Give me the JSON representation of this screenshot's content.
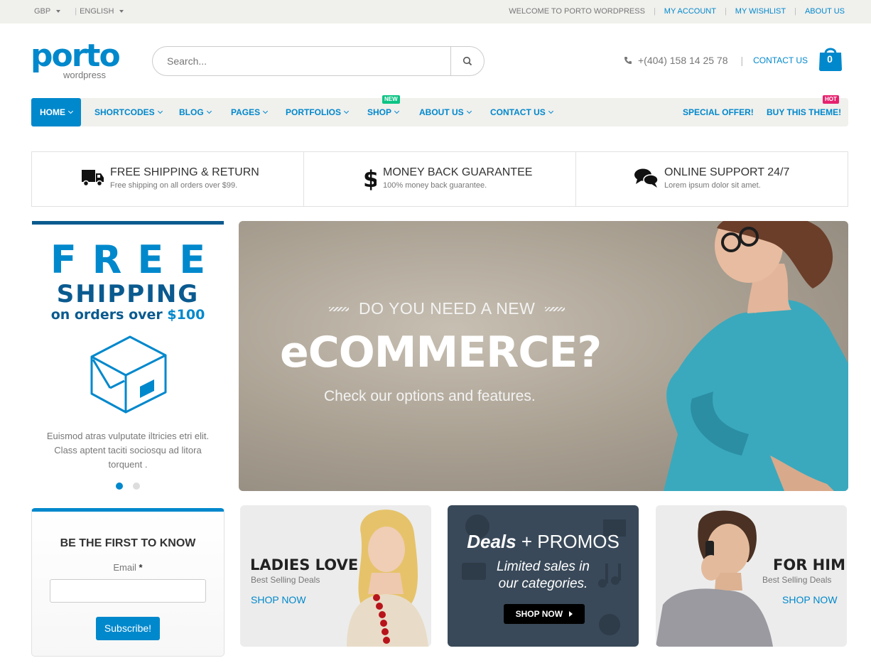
{
  "topbar": {
    "currency": "GBP",
    "language": "ENGLISH",
    "welcome": "WELCOME TO PORTO WORDPRESS",
    "links": [
      "MY ACCOUNT",
      "MY WISHLIST",
      "ABOUT US"
    ]
  },
  "header": {
    "logo_word": "porto",
    "logo_sub": "wordpress",
    "search_placeholder": "Search...",
    "phone": "+(404) 158 14 25 78",
    "contact": "CONTACT US",
    "cart_count": "0"
  },
  "nav": {
    "items": [
      "HOME",
      "SHORTCODES",
      "BLOG",
      "PAGES",
      "PORTFOLIOS",
      "SHOP",
      "ABOUT US",
      "CONTACT US"
    ],
    "right": [
      "SPECIAL OFFER!",
      "BUY THIS THEME!"
    ],
    "badge_new": "NEW",
    "badge_hot": "HOT"
  },
  "features": [
    {
      "title": "FREE SHIPPING & RETURN",
      "desc": "Free shipping on all orders over $99.",
      "icon": "truck-icon"
    },
    {
      "title": "MONEY BACK GUARANTEE",
      "desc": "100% money back guarantee.",
      "icon": "dollar-icon"
    },
    {
      "title": "ONLINE SUPPORT 24/7",
      "desc": "Lorem ipsum dolor sit amet.",
      "icon": "chat-icon"
    }
  ],
  "sidebar_banner": {
    "free": "FREE",
    "shipping": "SHIPPING",
    "orders_prefix": "on orders over ",
    "orders_amount": "$100",
    "text": "Euismod atras vulputate iltricies etri elit. Class aptent taciti sociosqu ad litora torquent ."
  },
  "hero": {
    "pre": "DO YOU NEED A NEW",
    "big": "eCOMMERCE?",
    "sub": "Check our options and features."
  },
  "newsletter": {
    "title": "BE THE FIRST TO KNOW",
    "email_label": "Email",
    "required": "*",
    "button": "Subscribe!"
  },
  "promos": {
    "ladies": {
      "title": "LADIES LOVE",
      "subtitle": "Best Selling Deals",
      "link": "SHOP NOW"
    },
    "deals": {
      "deals": "Deals",
      "plus": " + PROMOS",
      "line1": "Limited sales in",
      "line2": "our categories.",
      "button": "SHOP NOW"
    },
    "him": {
      "title": "FOR HIM",
      "subtitle": "Best Selling Deals",
      "link": "SHOP NOW"
    }
  },
  "colors": {
    "accent": "#0088cc",
    "dark_blue": "#0a5a8f",
    "deals_bg": "#394959"
  }
}
